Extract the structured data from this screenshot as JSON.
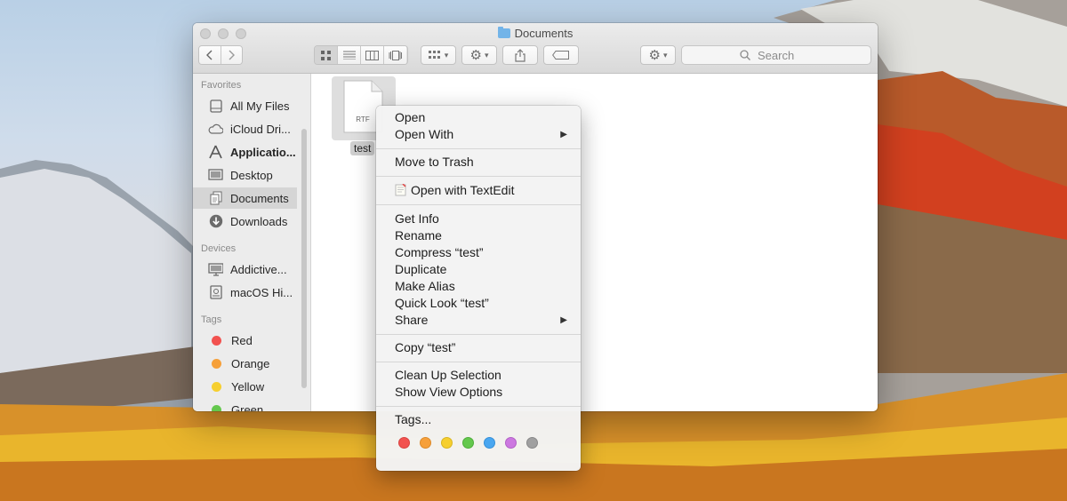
{
  "window": {
    "title": "Documents",
    "search_placeholder": "Search"
  },
  "sidebar": {
    "favorites_label": "Favorites",
    "favorites": [
      {
        "label": "All My Files",
        "icon": "all-files-icon"
      },
      {
        "label": "iCloud Dri...",
        "icon": "cloud-icon"
      },
      {
        "label": "Applicatio...",
        "icon": "applications-icon"
      },
      {
        "label": "Desktop",
        "icon": "desktop-icon"
      },
      {
        "label": "Documents",
        "icon": "documents-icon"
      },
      {
        "label": "Downloads",
        "icon": "downloads-icon"
      }
    ],
    "devices_label": "Devices",
    "devices": [
      {
        "label": "Addictive...",
        "icon": "computer-icon"
      },
      {
        "label": "macOS Hi...",
        "icon": "disk-icon"
      }
    ],
    "tags_label": "Tags",
    "tags": [
      {
        "label": "Red",
        "color": "#f2524f"
      },
      {
        "label": "Orange",
        "color": "#f6a03a"
      },
      {
        "label": "Yellow",
        "color": "#f6cf2f"
      },
      {
        "label": "Green",
        "color": "#64c84d"
      }
    ]
  },
  "file": {
    "name": "test",
    "type_label": "RTF"
  },
  "context_menu": {
    "open": "Open",
    "open_with": "Open With",
    "move_to_trash": "Move to Trash",
    "open_with_textedit": "Open with TextEdit",
    "get_info": "Get Info",
    "rename": "Rename",
    "compress": "Compress “test”",
    "duplicate": "Duplicate",
    "make_alias": "Make Alias",
    "quick_look": "Quick Look “test”",
    "share": "Share",
    "copy": "Copy “test”",
    "clean_up": "Clean Up Selection",
    "show_view_options": "Show View Options",
    "tags": "Tags...",
    "tag_colors": [
      "#f2524f",
      "#f6a03a",
      "#f6cf2f",
      "#64c84d",
      "#4aa7f0",
      "#cc78e0",
      "#a0a0a0"
    ]
  }
}
